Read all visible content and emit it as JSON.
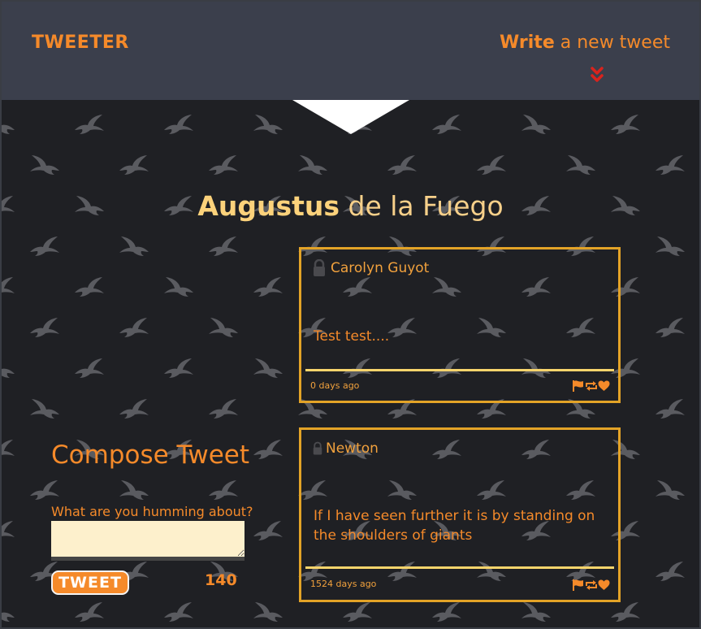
{
  "nav": {
    "logo": "TWEETER",
    "compose_bold": "Write",
    "compose_rest": " a new tweet"
  },
  "profile": {
    "first_name": "Augustus",
    "last_name": " de la Fuego"
  },
  "tweets": [
    {
      "author": "Carolyn Guyot",
      "text": "Test test....",
      "age": "0 days ago"
    },
    {
      "author": "Newton",
      "text": "If I have seen further it is by standing on the shoulders of giants",
      "age": "1524 days ago"
    }
  ],
  "compose": {
    "title": "Compose Tweet",
    "label": "What are you humming about?",
    "value": "",
    "button": "TWEET",
    "counter": "140"
  },
  "icons": {
    "toggle": "double-chevron-down-icon",
    "lock": "lock-icon",
    "flag": "flag-icon",
    "retweet": "retweet-icon",
    "like": "heart-icon"
  },
  "colors": {
    "accent": "#f58a2a",
    "nav_bg": "#3b3f4c",
    "page_bg": "#1f2024",
    "tweet_border": "#e3a327",
    "name_highlight": "#fcd27b",
    "toggle_chevron": "#d9231d",
    "textarea_bg": "#fdf0cc"
  }
}
